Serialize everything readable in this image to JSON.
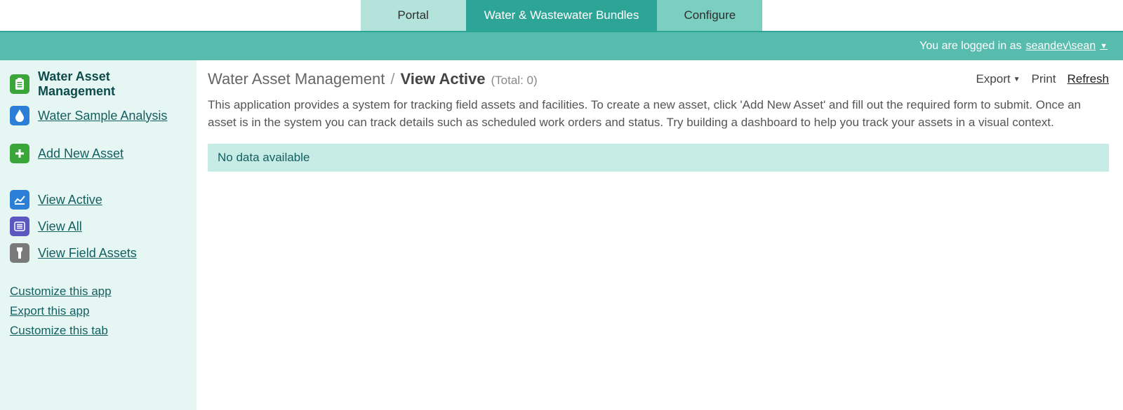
{
  "topnav": {
    "portal": "Portal",
    "bundles": "Water & Wastewater Bundles",
    "configure": "Configure"
  },
  "loginbar": {
    "prefix": "You are logged in as",
    "user": "seandev\\sean"
  },
  "sidebar": {
    "apps": [
      {
        "label": "Water Asset Management",
        "icon": "clipboard",
        "active": true
      },
      {
        "label": "Water Sample Analysis",
        "icon": "drop"
      }
    ],
    "add": {
      "label": "Add New Asset"
    },
    "views": [
      {
        "label": "View Active",
        "icon": "chart"
      },
      {
        "label": "View All",
        "icon": "list"
      },
      {
        "label": "View Field Assets",
        "icon": "flashlight"
      }
    ],
    "footer": {
      "customize_app": "Customize this app",
      "export_app": "Export this app",
      "customize_tab": "Customize this tab"
    }
  },
  "breadcrumb": {
    "app": "Water Asset Management",
    "sep": "/",
    "page": "View Active",
    "total": "(Total: 0)"
  },
  "actions": {
    "export": "Export",
    "print": "Print",
    "refresh": "Refresh"
  },
  "description": "This application provides a system for tracking field assets and facilities. To create a new asset, click 'Add New Asset' and fill out the required form to submit. Once an asset is in the system you can track details such as scheduled work orders and status. Try building a dashboard to help you track your assets in a visual context.",
  "nodata": "No data available"
}
